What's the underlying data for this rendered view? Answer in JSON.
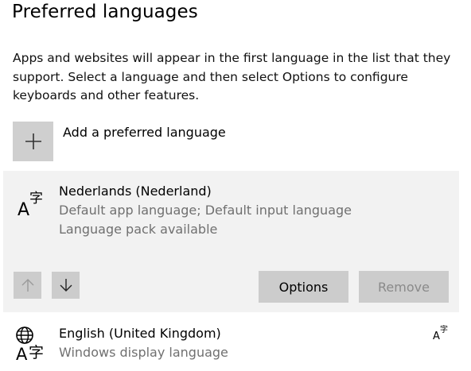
{
  "section": {
    "title": "Preferred languages",
    "description": "Apps and websites will appear in the first language in the list that they support. Select a language and then select Options to configure keyboards and other features."
  },
  "add_language": {
    "icon": "plus-icon",
    "label": "Add a preferred language"
  },
  "languages": [
    {
      "name": "Nederlands (Nederland)",
      "line1": "Default app language; Default input language",
      "line2": "Language pack available",
      "icon": "language-icon",
      "selected": true,
      "controls": {
        "move_up_icon": "arrow-up-icon",
        "move_down_icon": "arrow-down-icon",
        "options_label": "Options",
        "remove_label": "Remove"
      }
    },
    {
      "name": "English (United Kingdom)",
      "line1": "Windows display language",
      "icon": "display-language-icon",
      "feature_icon": "language-feature-icon"
    }
  ],
  "colors": {
    "selected_background": "#f2f2f2",
    "button_background": "#cccccc",
    "secondary_text": "#707070",
    "disabled_text": "#8a8a8a"
  }
}
